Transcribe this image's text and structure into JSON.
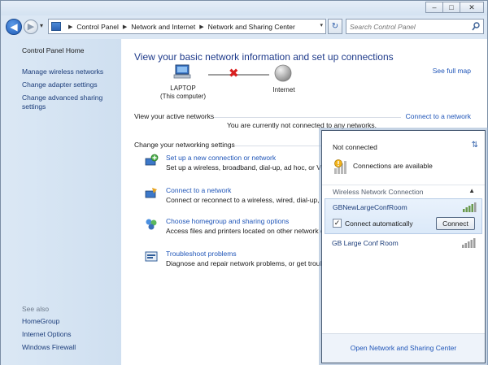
{
  "breadcrumbs": [
    "Control Panel",
    "Network and Internet",
    "Network and Sharing Center"
  ],
  "search": {
    "placeholder": "Search Control Panel"
  },
  "sidebar": {
    "home": "Control Panel Home",
    "items": [
      {
        "label": "Manage wireless networks"
      },
      {
        "label": "Change adapter settings"
      },
      {
        "label": "Change advanced sharing settings"
      }
    ],
    "see_also_title": "See also",
    "see_also": [
      {
        "label": "HomeGroup"
      },
      {
        "label": "Internet Options"
      },
      {
        "label": "Windows Firewall"
      }
    ]
  },
  "main": {
    "title": "View your basic network information and set up connections",
    "see_full_map": "See full map",
    "computer_name": "LAPTOP",
    "computer_sub": "(This computer)",
    "internet_label": "Internet",
    "active_networks_label": "View your active networks",
    "connect_to_network_link": "Connect to a network",
    "not_connected_message": "You are currently not connected to any networks.",
    "change_settings_label": "Change your networking settings",
    "tasks": [
      {
        "title": "Set up a new connection or network",
        "desc": "Set up a wireless, broadband, dial-up, ad hoc, or VP"
      },
      {
        "title": "Connect to a network",
        "desc": "Connect or reconnect to a wireless, wired, dial-up, a"
      },
      {
        "title": "Choose homegroup and sharing options",
        "desc": "Access files and printers located on other network c"
      },
      {
        "title": "Troubleshoot problems",
        "desc": "Diagnose and repair network problems, or get troubl"
      }
    ]
  },
  "flyout": {
    "status": "Not connected",
    "available": "Connections are available",
    "section": "Wireless Network Connection",
    "networks": [
      {
        "name": "GBNewLargeConfRoom"
      },
      {
        "name": "GB Large Conf Room"
      }
    ],
    "connect_auto_label": "Connect automatically",
    "connect_auto_checked": true,
    "connect_button": "Connect",
    "footer_link": "Open Network and Sharing Center"
  },
  "colors": {
    "link": "#1f55b8",
    "title": "#1e3a8a",
    "error": "#d92020"
  }
}
